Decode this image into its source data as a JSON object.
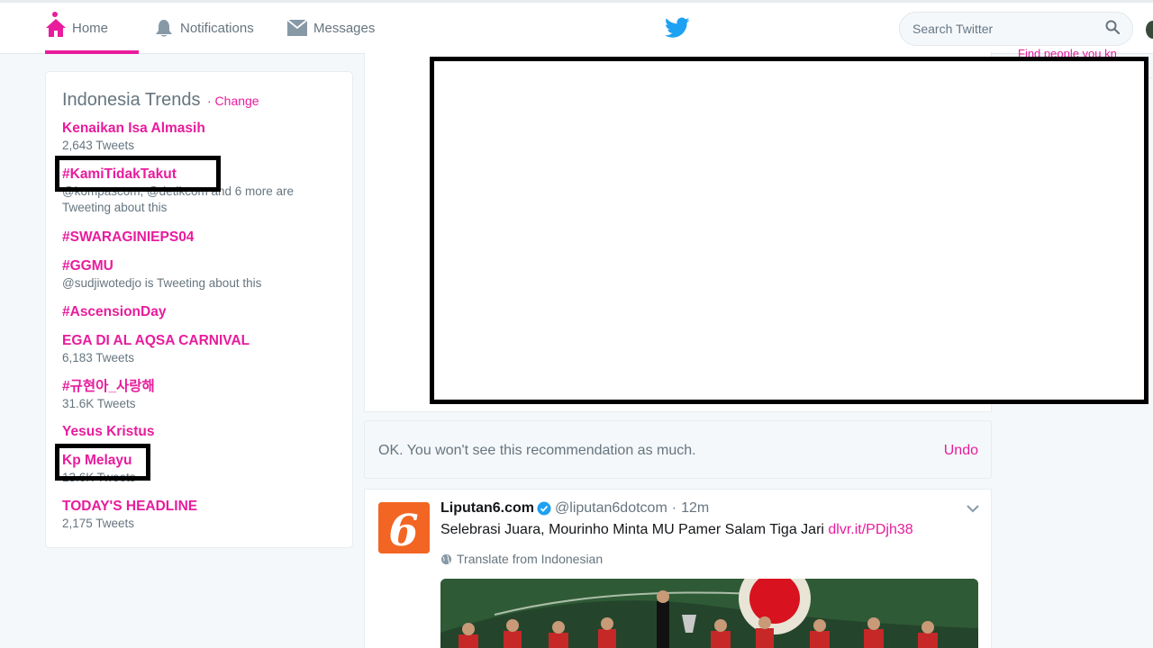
{
  "nav": {
    "home_label": "Home",
    "notifications_label": "Notifications",
    "messages_label": "Messages",
    "search_placeholder": "Search Twitter"
  },
  "trends": {
    "title": "Indonesia Trends",
    "change_label": "· Change",
    "items": [
      {
        "name": "Kenaikan Isa Almasih",
        "meta": "2,643 Tweets"
      },
      {
        "name": "#KamiTidakTakut",
        "meta": "@kompascom, @detikcom and 6 more are Tweeting about this"
      },
      {
        "name": "#SWARAGINIEPS04",
        "meta": ""
      },
      {
        "name": "#GGMU",
        "meta": "@sudjiwotedjo is Tweeting about this"
      },
      {
        "name": "#AscensionDay",
        "meta": ""
      },
      {
        "name": "EGA DI AL AQSA CARNIVAL",
        "meta": "6,183 Tweets"
      },
      {
        "name": "#규현아_사랑해",
        "meta": "31.6K Tweets"
      },
      {
        "name": "Yesus Kristus",
        "meta": ""
      },
      {
        "name": "Kp Melayu",
        "meta": "13.6K Tweets"
      },
      {
        "name": "TODAY'S HEADLINE",
        "meta": "2,175 Tweets"
      }
    ]
  },
  "right": {
    "find_people": "Find people you kn"
  },
  "notice": {
    "text": "OK. You won't see this recommendation as much.",
    "undo": "Undo"
  },
  "tweet": {
    "name": "Liputan6.com",
    "handle": "@liputan6dotcom",
    "sep": "·",
    "time": "12m",
    "text": "Selebrasi Juara, Mourinho Minta MU Pamer Salam Tiga Jari ",
    "link": "dlvr.it/PDjh38",
    "translate": "Translate from Indonesian",
    "avatar_glyph": "6"
  },
  "colors": {
    "accent": "#e81c9c",
    "twitter_blue": "#1da1f2",
    "avatar_orange": "#f26522"
  }
}
